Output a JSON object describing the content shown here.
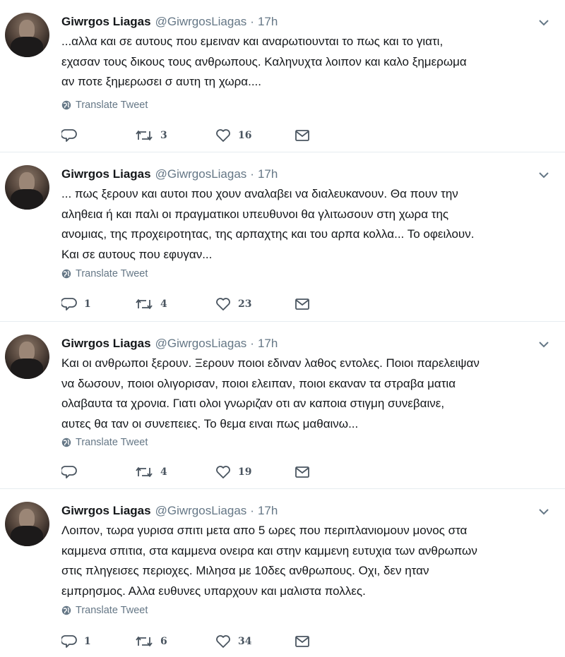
{
  "colors": {
    "text": "#14171a",
    "secondary": "#657786",
    "divider": "#e6ecf0"
  },
  "icons": {
    "reply": "reply-icon",
    "retweet": "retweet-icon",
    "like": "heart-icon",
    "message": "envelope-icon",
    "translate": "globe-icon",
    "menu": "chevron-down-icon"
  },
  "tweets": [
    {
      "name": "Giwrgos Liagas",
      "handle": "@GiwrgosLiagas",
      "sep": "·",
      "time": "17h",
      "lines": [
        "...αλλα και σε αυτους που εμειναν και αναρωτιουνται το πως και το γιατι,",
        "εχασαν τους δικους τους ανθρωπους. Καληνυχτα λοιπον και καλο ξημερωμα",
        "αν ποτε ξημερωσει σ αυτη τη χωρα...."
      ],
      "translate": "Translate Tweet",
      "replies": "",
      "retweets": "3",
      "likes": "16"
    },
    {
      "name": "Giwrgos Liagas",
      "handle": "@GiwrgosLiagas",
      "sep": "·",
      "time": "17h",
      "lines": [
        "... πως ξερουν και αυτοι που χουν αναλαβει να διαλευκανουν. Θα πουν την",
        "αληθεια ή και παλι οι πραγματικοι υπευθυνοι θα γλιτωσουν στη χωρα της",
        "ανομιας, της προχειροτητας, της αρπαχτης και του αρπα κολλα... Το οφειλουν.",
        "Και σε αυτους που εφυγαν..."
      ],
      "translate": "Translate Tweet",
      "replies": "1",
      "retweets": "4",
      "likes": "23"
    },
    {
      "name": "Giwrgos Liagas",
      "handle": "@GiwrgosLiagas",
      "sep": "·",
      "time": "17h",
      "lines": [
        "Και οι ανθρωποι ξερουν. Ξερουν ποιοι εδιναν λαθος εντολες. Ποιοι παρελειψαν",
        "να δωσουν, ποιοι ολιγορισαν, ποιοι ελειπαν, ποιοι εκαναν τα στραβα ματια",
        "ολαβαυτα τα χρονια. Γιατι ολοι γνωριζαν οτι αν καποια στιγμη συνεβαινε,",
        "αυτες θα ταν οι συνεπειες. Το θεμα ειναι πως μαθαινω..."
      ],
      "translate": "Translate Tweet",
      "replies": "",
      "retweets": "4",
      "likes": "19"
    },
    {
      "name": "Giwrgos Liagas",
      "handle": "@GiwrgosLiagas",
      "sep": "·",
      "time": "17h",
      "lines": [
        "Λοιπον, τωρα γυρισα σπιτι μετα απο 5 ωρες που περιπλανιομουν μονος στα",
        "καμμενα σπιτια, στα καμμενα ονειρα και στην καμμενη ευτυχια των ανθρωπων",
        "στις πληγεισες περιοχες. Μιλησα με 10δες ανθρωπους. Οχι, δεν ηταν",
        "εμπρησμος. Αλλα ευθυνες υπαρχουν και μαλιστα πολλες."
      ],
      "translate": "Translate Tweet",
      "replies": "1",
      "retweets": "6",
      "likes": "34"
    }
  ]
}
